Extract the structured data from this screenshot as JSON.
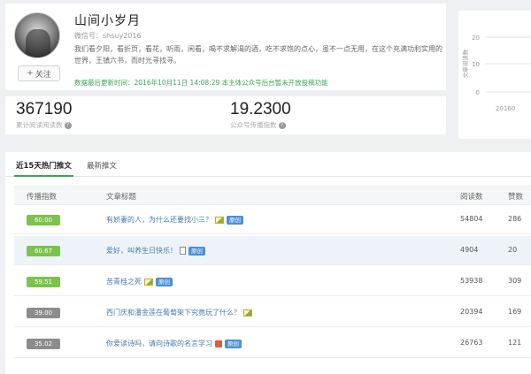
{
  "profile": {
    "name": "山间小岁月",
    "wechat_id": "微信号：shsuy2016",
    "description": "我们看夕阳，看折页，看花，听雨，闲看，喝不求解渴的酒，吃不求饱的点心，虽不一点无用，在这个充满功利实用的世界，王镇六书，而时光寻找寻。",
    "update_text": "数据最后更新时间：2016年10月11日 14:08:29 本主体公众号后台暂未开放投稿功能",
    "follow_label": "关注",
    "follow_icon": "plus-icon"
  },
  "stats": {
    "total_reads": "367190",
    "total_reads_label": "累计阅读阅读数",
    "wci": "19.2300",
    "wci_label": "公众号传播指数"
  },
  "side_chart": {
    "ticks": [
      "20",
      "10",
      "0"
    ],
    "ylabel": "文章阅读数",
    "xlabel": "20160"
  },
  "tabs": [
    {
      "label": "近15天热门推文",
      "active": true
    },
    {
      "label": "最新推文",
      "active": false
    }
  ],
  "table": {
    "headers": [
      "传播指数",
      "文章标题",
      "阅读数",
      "赞数"
    ],
    "rows": [
      {
        "index": "60.00",
        "color": "green",
        "title": "有娇妻的人，为什么还要找小三？",
        "img": true,
        "doc": false,
        "vid": false,
        "tag": "原创",
        "reads": "54804",
        "likes": "286",
        "highlight": false
      },
      {
        "index": "60.67",
        "color": "green",
        "title": "爱好，叫养生日快乐！",
        "img": false,
        "doc": true,
        "vid": false,
        "tag": "原创",
        "reads": "4904",
        "likes": "20",
        "highlight": true
      },
      {
        "index": "59.51",
        "color": "green",
        "title": "苦青桂之死",
        "img": true,
        "doc": false,
        "vid": false,
        "tag": "原创",
        "reads": "53938",
        "likes": "309",
        "highlight": false
      },
      {
        "index": "39.00",
        "color": "gray",
        "title": "西门庆和潘金莲在葡萄架下究竟玩了什么？",
        "img": true,
        "doc": false,
        "vid": false,
        "tag": "",
        "reads": "20394",
        "likes": "169",
        "highlight": false
      },
      {
        "index": "35.02",
        "color": "gray",
        "title": "你爱读诗吗，请向诗歌的名言学习",
        "img": false,
        "doc": false,
        "vid": true,
        "tag": "原创",
        "reads": "26763",
        "likes": "121",
        "highlight": false
      }
    ]
  }
}
